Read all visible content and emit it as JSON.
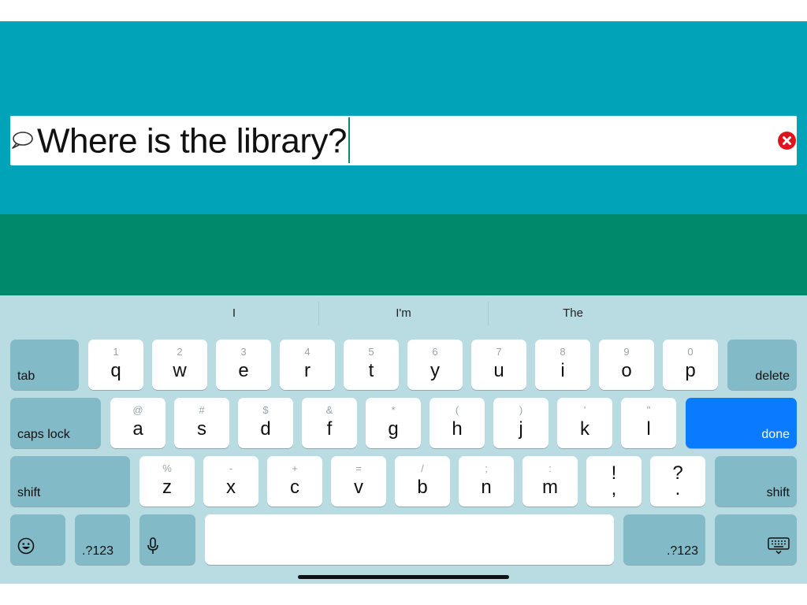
{
  "speech": {
    "text": "Where is the library?"
  },
  "suggestions": [
    "I",
    "I'm",
    "The"
  ],
  "keys": {
    "row1": [
      {
        "main": "q",
        "alt": "1"
      },
      {
        "main": "w",
        "alt": "2"
      },
      {
        "main": "e",
        "alt": "3"
      },
      {
        "main": "r",
        "alt": "4"
      },
      {
        "main": "t",
        "alt": "5"
      },
      {
        "main": "y",
        "alt": "6"
      },
      {
        "main": "u",
        "alt": "7"
      },
      {
        "main": "i",
        "alt": "8"
      },
      {
        "main": "o",
        "alt": "9"
      },
      {
        "main": "p",
        "alt": "0"
      }
    ],
    "row2": [
      {
        "main": "a",
        "alt": "@"
      },
      {
        "main": "s",
        "alt": "#"
      },
      {
        "main": "d",
        "alt": "$"
      },
      {
        "main": "f",
        "alt": "&"
      },
      {
        "main": "g",
        "alt": "*"
      },
      {
        "main": "h",
        "alt": "("
      },
      {
        "main": "j",
        "alt": ")"
      },
      {
        "main": "k",
        "alt": "'"
      },
      {
        "main": "l",
        "alt": "\""
      }
    ],
    "row3": [
      {
        "main": "z",
        "alt": "%"
      },
      {
        "main": "x",
        "alt": "-"
      },
      {
        "main": "c",
        "alt": "+"
      },
      {
        "main": "v",
        "alt": "="
      },
      {
        "main": "b",
        "alt": "/"
      },
      {
        "main": "n",
        "alt": ";"
      },
      {
        "main": "m",
        "alt": ":"
      }
    ],
    "punct": [
      {
        "top": "!",
        "bottom": ","
      },
      {
        "top": "?",
        "bottom": "."
      }
    ],
    "tab": "tab",
    "delete": "delete",
    "caps_lock": "caps lock",
    "done": "done",
    "shift_left": "shift",
    "shift_right": "shift",
    "numbers_left": ".?123",
    "numbers_right": ".?123"
  },
  "icons": {
    "speech": "speech-bubble-icon",
    "clear": "clear-circle-x-icon",
    "emoji": "emoji-icon",
    "mic": "microphone-icon",
    "keyboard_hide": "keyboard-dismiss-icon"
  },
  "colors": {
    "top_band": "#00a3b8",
    "green_band": "#00896a",
    "keyboard_bg": "#b9dbe2",
    "func_key": "#83bac7",
    "done_key": "#0a7bff",
    "clear_button": "#e0141e"
  }
}
